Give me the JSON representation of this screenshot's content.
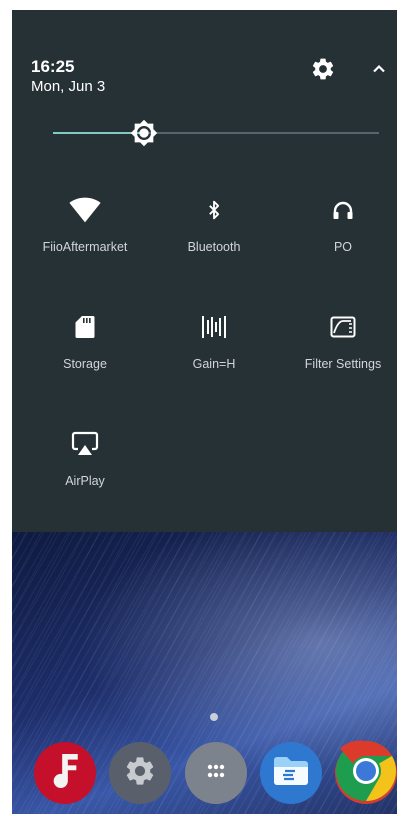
{
  "status": {
    "time": "16:25",
    "date": "Mon, Jun 3"
  },
  "header": {
    "settings_icon": "gear-icon",
    "collapse_icon": "chevron-up-icon"
  },
  "brightness": {
    "level": 0.28,
    "fill_color": "#7fcbc4",
    "track_color": "#56656c"
  },
  "tiles": [
    {
      "label": "FiioAftermarket",
      "icon": "wifi-icon"
    },
    {
      "label": "Bluetooth",
      "icon": "bluetooth-icon"
    },
    {
      "label": "PO",
      "icon": "headphones-icon"
    },
    {
      "label": "Storage",
      "icon": "sd-card-icon"
    },
    {
      "label": "Gain=H",
      "icon": "gain-icon"
    },
    {
      "label": "Filter Settings",
      "icon": "filter-icon"
    },
    {
      "label": "AirPlay",
      "icon": "airplay-icon"
    }
  ],
  "dock": [
    {
      "app": "fiio-music",
      "icon": "music-note-icon",
      "color": "#c4102a"
    },
    {
      "app": "settings",
      "icon": "gear-icon",
      "color": "#59606b"
    },
    {
      "app": "app-drawer",
      "icon": "app-drawer-icon",
      "color": "#7d838c"
    },
    {
      "app": "es-file-explorer",
      "icon": "folder-icon",
      "color": "#2f78d0"
    },
    {
      "app": "chrome",
      "icon": "chrome-icon",
      "color": "#d63b2f"
    }
  ],
  "colors": {
    "panel": "#263136",
    "text": "#ffffff",
    "label": "#d2d6d8"
  }
}
